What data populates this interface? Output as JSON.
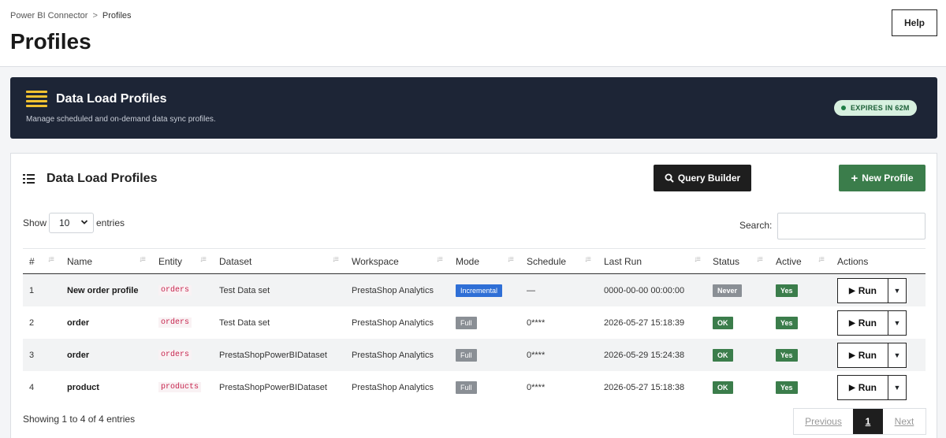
{
  "breadcrumb": {
    "parent": "Power BI Connector",
    "separator": ">",
    "current": "Profiles"
  },
  "page_title": "Profiles",
  "help_label": "Help",
  "banner": {
    "title": "Data Load Profiles",
    "subtitle": "Manage scheduled and on-demand data sync profiles.",
    "expires": "EXPIRES IN 62M"
  },
  "card": {
    "title": "Data Load Profiles",
    "query_builder_label": "Query Builder",
    "new_profile_label": "New Profile"
  },
  "controls": {
    "show_label": "Show",
    "entries_value": "10",
    "entries_label": "entries",
    "search_label": "Search:",
    "search_value": ""
  },
  "table": {
    "headers": [
      "#",
      "Name",
      "Entity",
      "Dataset",
      "Workspace",
      "Mode",
      "Schedule",
      "Last Run",
      "Status",
      "Active",
      "Actions"
    ],
    "rows": [
      {
        "num": "1",
        "name": "New order profile",
        "entity": "orders",
        "dataset": "Test Data set",
        "workspace": "PrestaShop Analytics",
        "mode": "Incremental",
        "schedule": "—",
        "last_run": "0000-00-00 00:00:00",
        "status": "Never",
        "active": "Yes",
        "run": "Run"
      },
      {
        "num": "2",
        "name": "order",
        "entity": "orders",
        "dataset": "Test Data set",
        "workspace": "PrestaShop Analytics",
        "mode": "Full",
        "schedule": "0****",
        "last_run": "2026-05-27 15:18:39",
        "status": "OK",
        "active": "Yes",
        "run": "Run"
      },
      {
        "num": "3",
        "name": "order",
        "entity": "orders",
        "dataset": "PrestaShopPowerBIDataset",
        "workspace": "PrestaShop Analytics",
        "mode": "Full",
        "schedule": "0****",
        "last_run": "2026-05-29 15:24:38",
        "status": "OK",
        "active": "Yes",
        "run": "Run"
      },
      {
        "num": "4",
        "name": "product",
        "entity": "products",
        "dataset": "PrestaShopPowerBIDataset",
        "workspace": "PrestaShop Analytics",
        "mode": "Full",
        "schedule": "0****",
        "last_run": "2026-05-27 15:18:38",
        "status": "OK",
        "active": "Yes",
        "run": "Run"
      }
    ]
  },
  "footer": {
    "info": "Showing 1 to 4 of 4 entries",
    "prev_label": "Previous",
    "current_page": "1",
    "next_label": "Next"
  },
  "colors": {
    "banner_bg": "#1d2536",
    "accent_yellow": "#f2c230",
    "success_green": "#3b7d4b",
    "incremental_blue": "#2f6fd6",
    "muted_gray": "#8a8f95"
  }
}
